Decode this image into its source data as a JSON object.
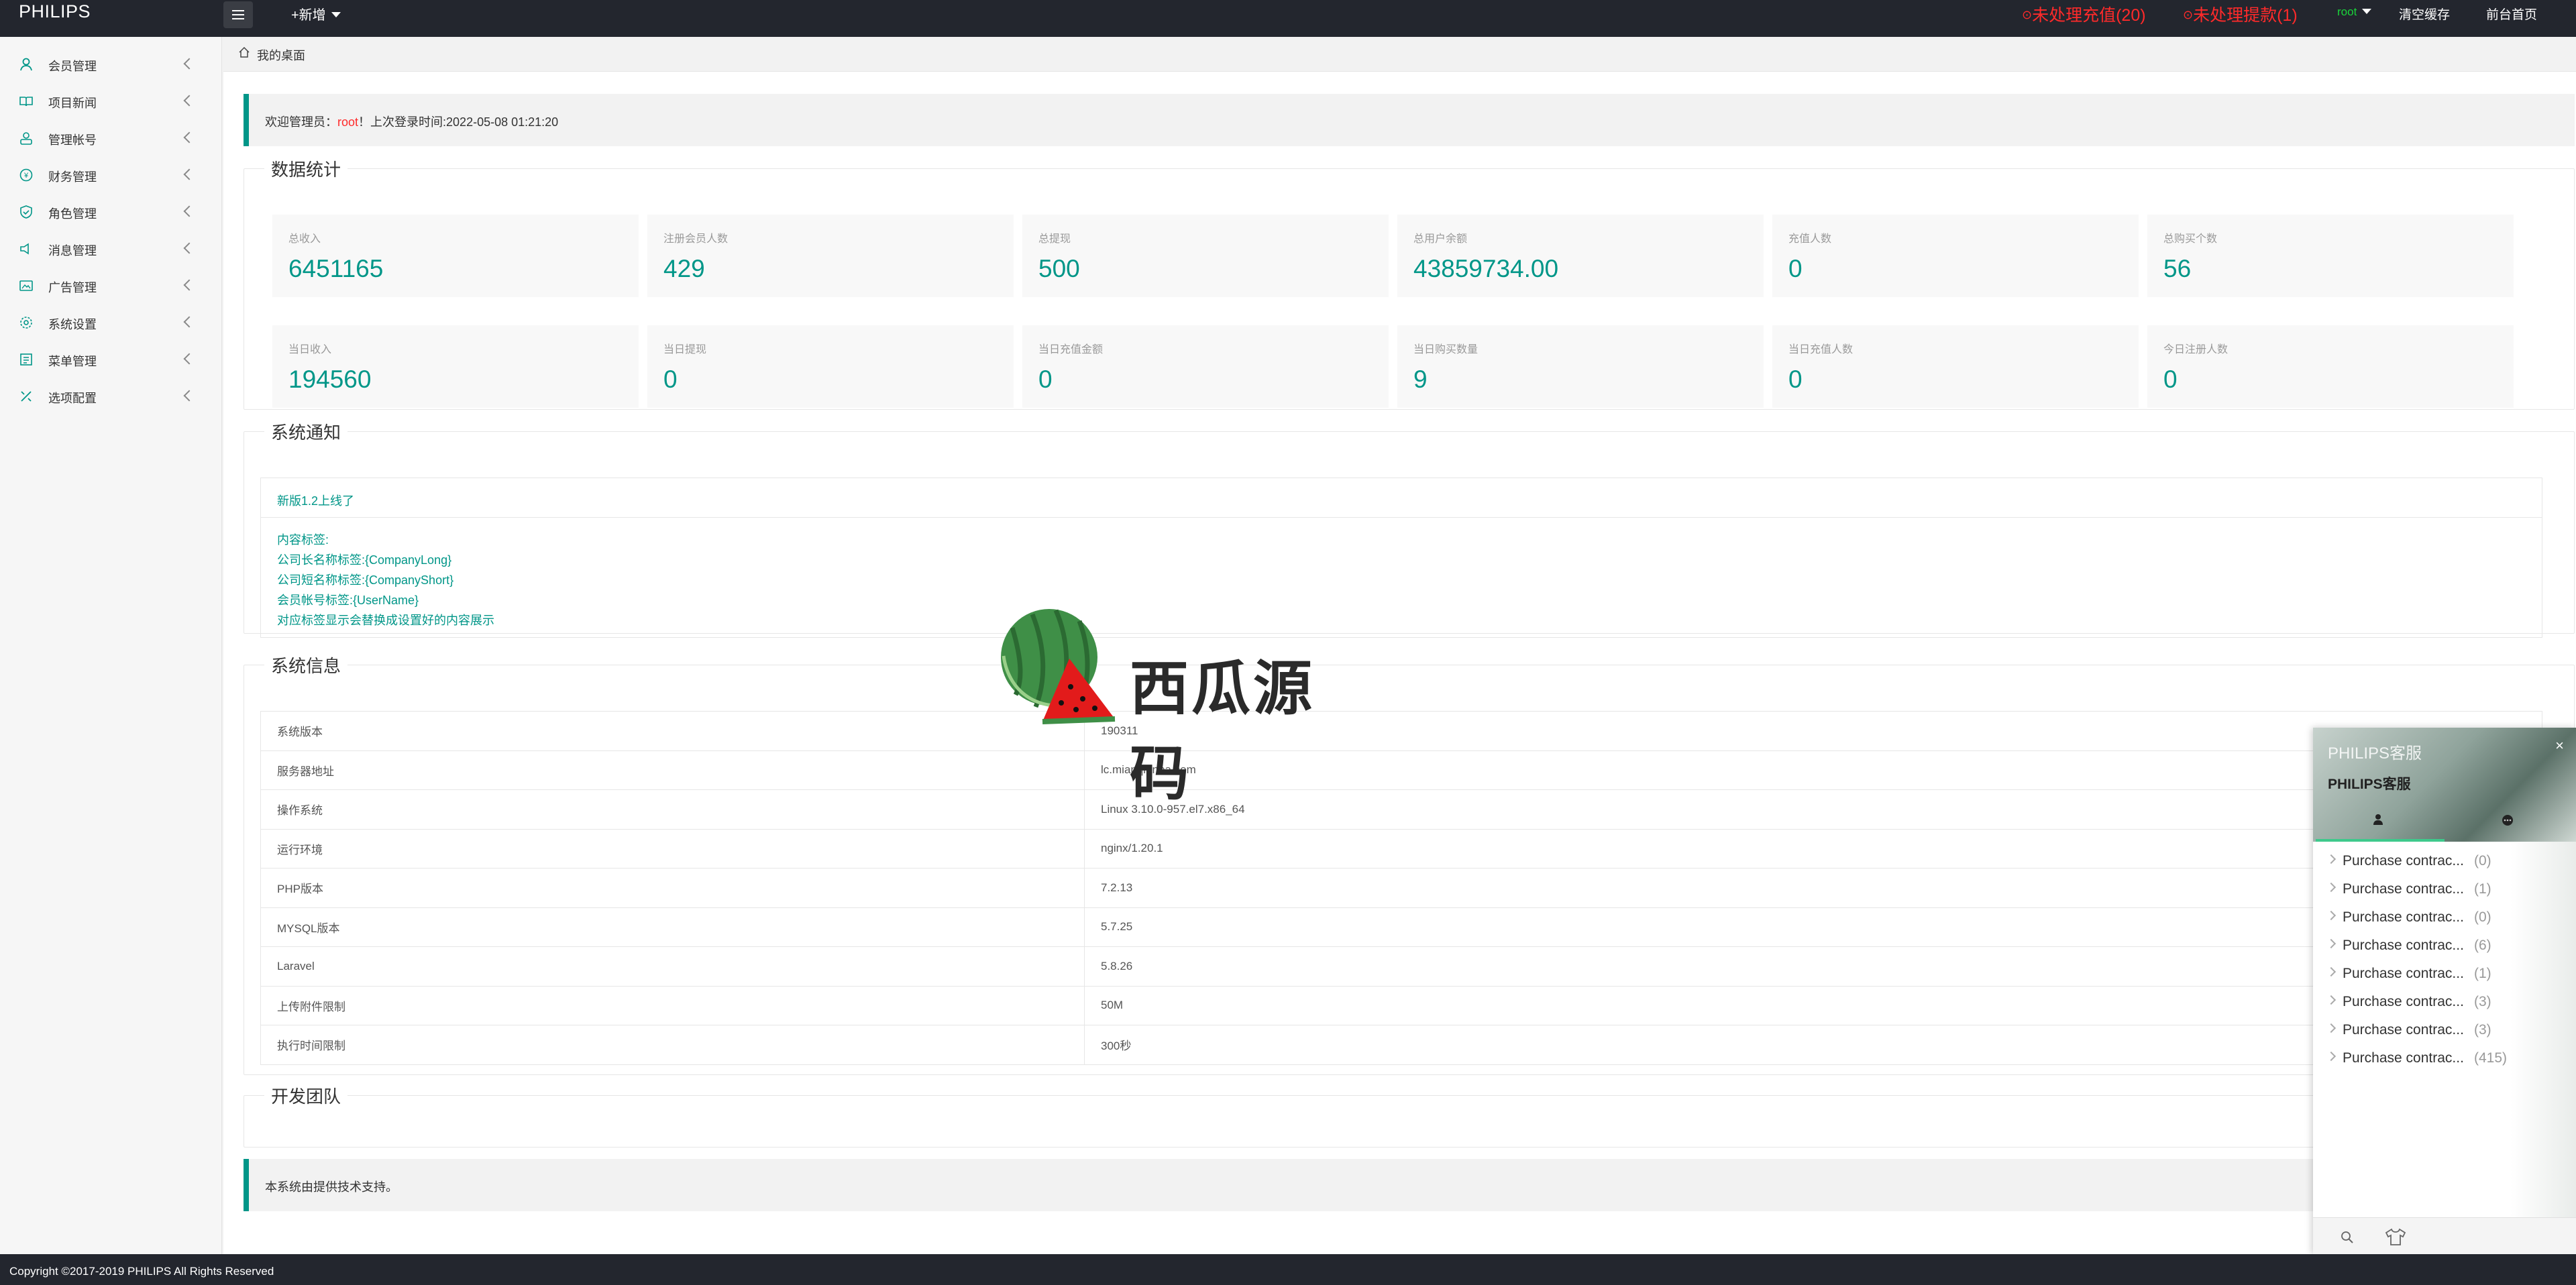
{
  "header": {
    "logo": "PHILIPS",
    "add_new": "+新增",
    "pending_recharge": "未处理充值(20)",
    "pending_withdraw": "未处理提款(1)",
    "user": "root",
    "clear_cache": "清空缓存",
    "frontend_home": "前台首页"
  },
  "sidebar": {
    "items": [
      {
        "label": "会员管理",
        "icon": "user-icon"
      },
      {
        "label": "项目新闻",
        "icon": "book-icon"
      },
      {
        "label": "管理帐号",
        "icon": "admin-icon"
      },
      {
        "label": "财务管理",
        "icon": "finance-icon"
      },
      {
        "label": "角色管理",
        "icon": "shield-icon"
      },
      {
        "label": "消息管理",
        "icon": "message-icon"
      },
      {
        "label": "广告管理",
        "icon": "ad-icon"
      },
      {
        "label": "系统设置",
        "icon": "gear-icon"
      },
      {
        "label": "菜单管理",
        "icon": "menu-icon"
      },
      {
        "label": "选项配置",
        "icon": "option-icon"
      }
    ]
  },
  "breadcrumb": "我的桌面",
  "welcome": {
    "prefix": "欢迎管理员：",
    "user": "root",
    "suffix": "！上次登录时间:2022-05-08 01:21:20"
  },
  "stats": {
    "title": "数据统计",
    "items": [
      {
        "label": "总收入",
        "value": "6451165"
      },
      {
        "label": "注册会员人数",
        "value": "429"
      },
      {
        "label": "总提现",
        "value": "500"
      },
      {
        "label": "总用户余额",
        "value": "43859734.00"
      },
      {
        "label": "充值人数",
        "value": "0"
      },
      {
        "label": "总购买个数",
        "value": "56"
      },
      {
        "label": "当日收入",
        "value": "194560"
      },
      {
        "label": "当日提现",
        "value": "0"
      },
      {
        "label": "当日充值金额",
        "value": "0"
      },
      {
        "label": "当日购买数量",
        "value": "9"
      },
      {
        "label": "当日充值人数",
        "value": "0"
      },
      {
        "label": "今日注册人数",
        "value": "0"
      }
    ]
  },
  "notice": {
    "title": "系统通知",
    "headline": "新版1.2上线了",
    "lines": [
      "内容标签:",
      "公司长名称标签:{CompanyLong}",
      "公司短名称标签:{CompanyShort}",
      "会员帐号标签:{UserName}",
      "对应标签显示会替换成设置好的内容展示"
    ]
  },
  "sysinfo": {
    "title": "系统信息",
    "rows": [
      {
        "k": "系统版本",
        "v": "190311"
      },
      {
        "k": "服务器地址",
        "v": "lc.mianqianba.com"
      },
      {
        "k": "操作系统",
        "v": "Linux 3.10.0-957.el7.x86_64"
      },
      {
        "k": "运行环境",
        "v": "nginx/1.20.1"
      },
      {
        "k": "PHP版本",
        "v": "7.2.13"
      },
      {
        "k": "MYSQL版本",
        "v": "5.7.25"
      },
      {
        "k": "Laravel",
        "v": "5.8.26"
      },
      {
        "k": "上传附件限制",
        "v": "50M"
      },
      {
        "k": "执行时间限制",
        "v": "300秒"
      }
    ]
  },
  "team": {
    "title": "开发团队"
  },
  "support": "本系统由提供技术支持。",
  "footer": "Copyright ©2017-2019 PHILIPS All Rights Reserved",
  "watermark": {
    "text": "西瓜源码"
  },
  "chat": {
    "title": "PHILIPS客服",
    "subtitle": "PHILIPS客服",
    "close": "×",
    "items": [
      {
        "name": "Purchase contrac...",
        "count": "(0)"
      },
      {
        "name": "Purchase contrac...",
        "count": "(1)"
      },
      {
        "name": "Purchase contrac...",
        "count": "(0)"
      },
      {
        "name": "Purchase contrac...",
        "count": "(6)"
      },
      {
        "name": "Purchase contrac...",
        "count": "(1)"
      },
      {
        "name": "Purchase contrac...",
        "count": "(3)"
      },
      {
        "name": "Purchase contrac...",
        "count": "(3)"
      },
      {
        "name": "Purchase contrac...",
        "count": "(415)"
      }
    ]
  },
  "colors": {
    "accent": "#009688",
    "header_bg": "#23262e",
    "alert": "#ff2a2a"
  }
}
